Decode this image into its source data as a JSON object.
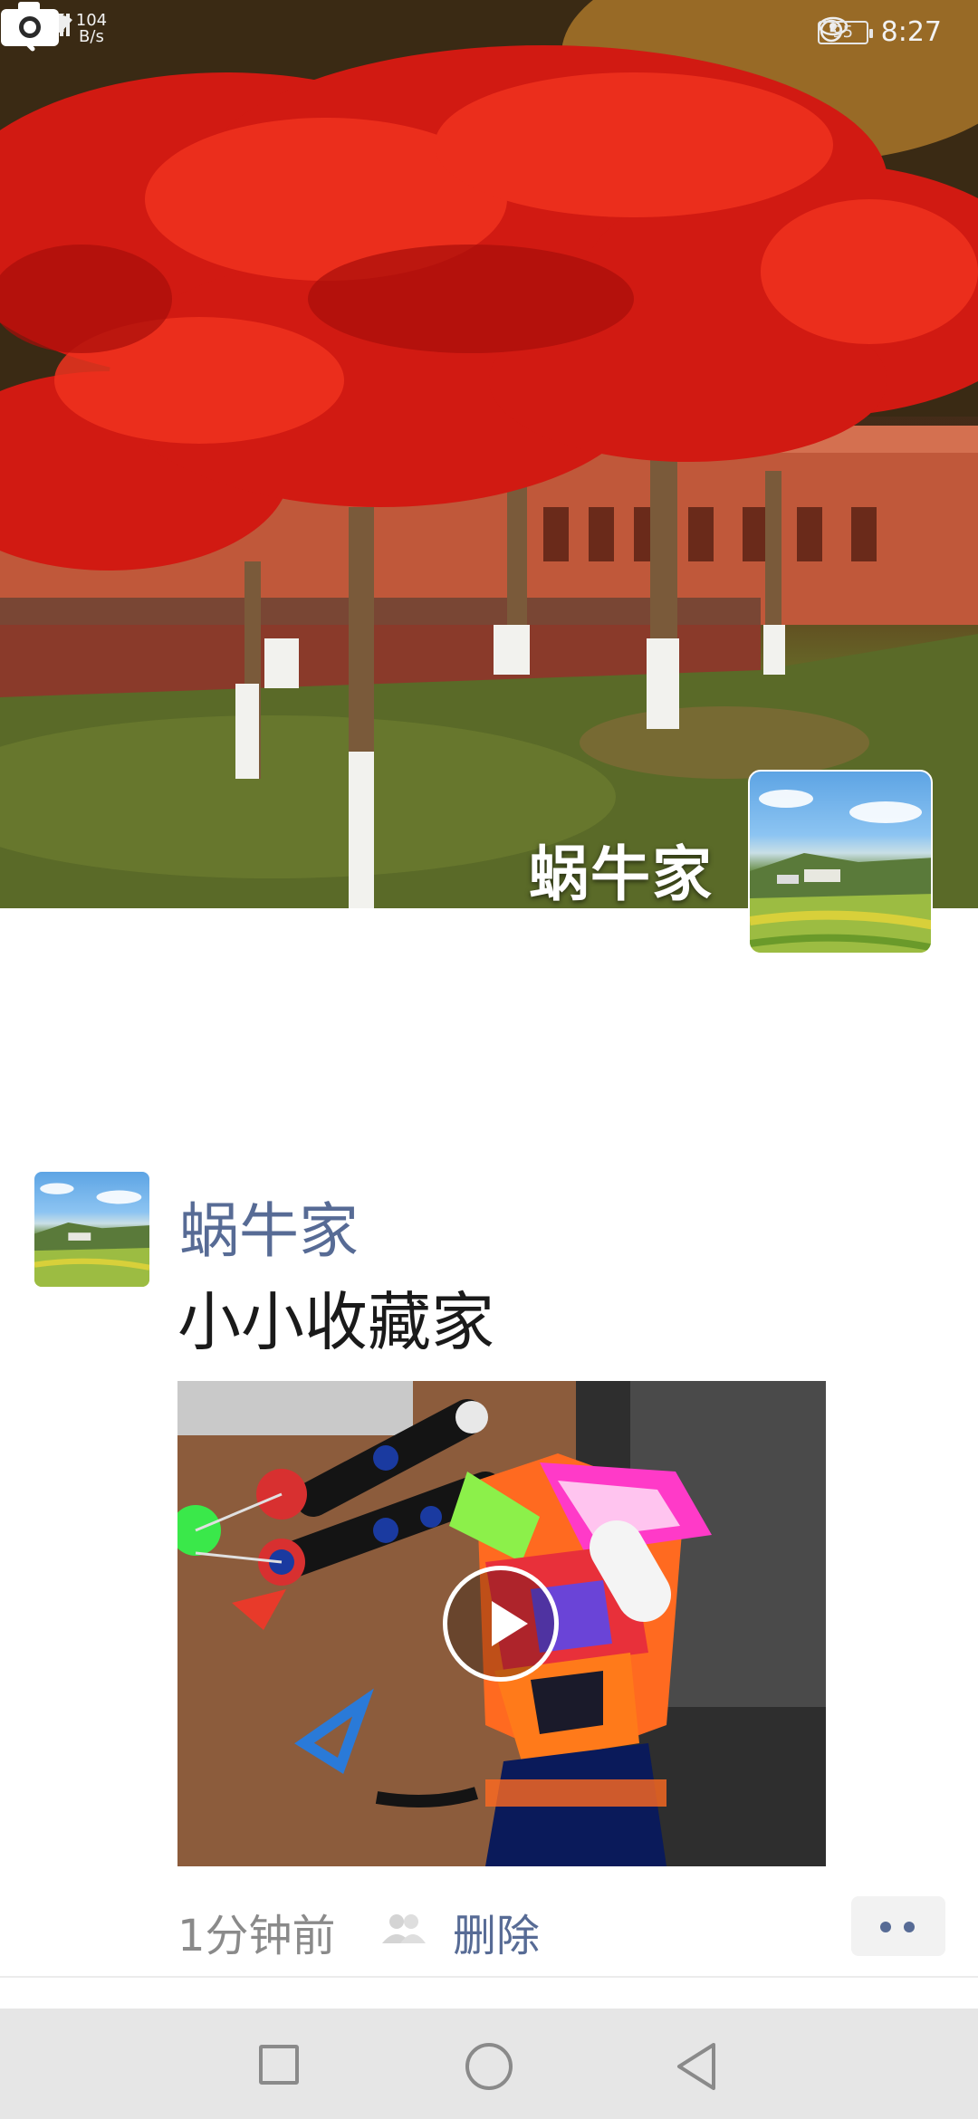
{
  "status_bar": {
    "network": "4G",
    "speed_value": "104",
    "speed_unit": "B/s",
    "battery": "95",
    "time": "8:27"
  },
  "cover": {
    "username": "蜗牛家"
  },
  "icons": {
    "back": "chevron-left-icon",
    "camera": "camera-icon",
    "visibility": "friends-icon",
    "more": "more-dots-icon"
  },
  "post": {
    "author": "蜗牛家",
    "text": "小小收藏家",
    "media_type": "video",
    "time": "1分钟前",
    "delete_label": "删除"
  },
  "colors": {
    "link": "#576b95",
    "meta": "#8a8a8a",
    "navbar": "#e6e6e6"
  }
}
